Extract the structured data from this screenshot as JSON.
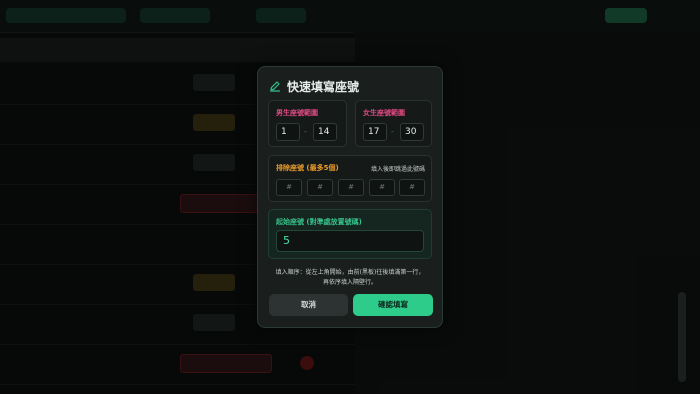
{
  "modal": {
    "title": "快速填寫座號",
    "male": {
      "label": "男生座號範圍",
      "from": "1",
      "to": "14"
    },
    "female": {
      "label": "女生座號範圍",
      "from": "17",
      "to": "30"
    },
    "exclude": {
      "label": "排除座號 (最多5個)",
      "hint": "填入後即跳過此號碼",
      "placeholders": [
        "#",
        "#",
        "#",
        "#",
        "#"
      ]
    },
    "start": {
      "label": "起始座號 (對準處放置號碼)",
      "value": "5"
    },
    "note_line1": "填入順序：從左上角開始，由前(黑板)往後填滿第一行，",
    "note_line2": "再依序填入隔壁行。",
    "cancel_label": "取消",
    "confirm_label": "確認填寫"
  },
  "colors": {
    "accent": "#2ecc8a",
    "male_label": "#e04a82",
    "exclude_label": "#e89a2a",
    "start_label": "#36c18a"
  },
  "icons": {
    "title_icon": "pencil-icon"
  }
}
